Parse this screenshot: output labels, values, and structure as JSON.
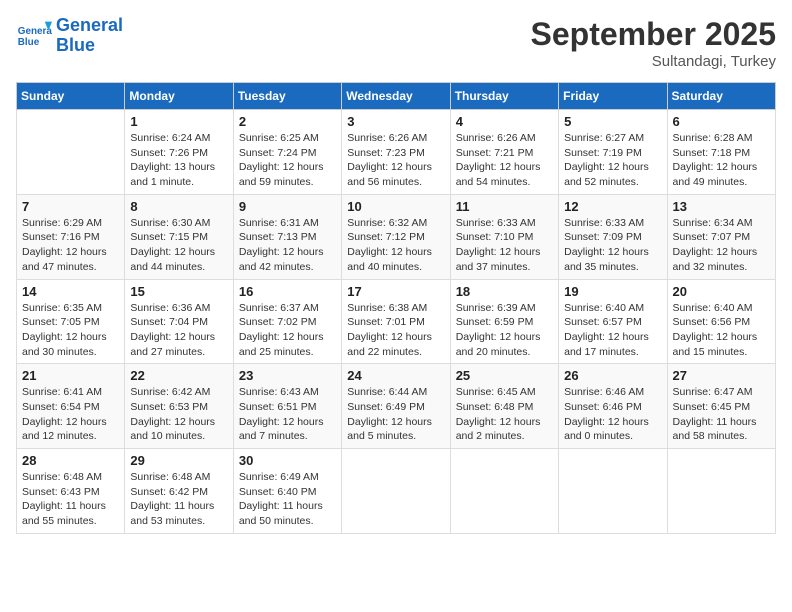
{
  "logo": {
    "line1": "General",
    "line2": "Blue"
  },
  "title": "September 2025",
  "subtitle": "Sultandagi, Turkey",
  "weekdays": [
    "Sunday",
    "Monday",
    "Tuesday",
    "Wednesday",
    "Thursday",
    "Friday",
    "Saturday"
  ],
  "weeks": [
    [
      {
        "day": "",
        "info": ""
      },
      {
        "day": "1",
        "info": "Sunrise: 6:24 AM\nSunset: 7:26 PM\nDaylight: 13 hours\nand 1 minute."
      },
      {
        "day": "2",
        "info": "Sunrise: 6:25 AM\nSunset: 7:24 PM\nDaylight: 12 hours\nand 59 minutes."
      },
      {
        "day": "3",
        "info": "Sunrise: 6:26 AM\nSunset: 7:23 PM\nDaylight: 12 hours\nand 56 minutes."
      },
      {
        "day": "4",
        "info": "Sunrise: 6:26 AM\nSunset: 7:21 PM\nDaylight: 12 hours\nand 54 minutes."
      },
      {
        "day": "5",
        "info": "Sunrise: 6:27 AM\nSunset: 7:19 PM\nDaylight: 12 hours\nand 52 minutes."
      },
      {
        "day": "6",
        "info": "Sunrise: 6:28 AM\nSunset: 7:18 PM\nDaylight: 12 hours\nand 49 minutes."
      }
    ],
    [
      {
        "day": "7",
        "info": "Sunrise: 6:29 AM\nSunset: 7:16 PM\nDaylight: 12 hours\nand 47 minutes."
      },
      {
        "day": "8",
        "info": "Sunrise: 6:30 AM\nSunset: 7:15 PM\nDaylight: 12 hours\nand 44 minutes."
      },
      {
        "day": "9",
        "info": "Sunrise: 6:31 AM\nSunset: 7:13 PM\nDaylight: 12 hours\nand 42 minutes."
      },
      {
        "day": "10",
        "info": "Sunrise: 6:32 AM\nSunset: 7:12 PM\nDaylight: 12 hours\nand 40 minutes."
      },
      {
        "day": "11",
        "info": "Sunrise: 6:33 AM\nSunset: 7:10 PM\nDaylight: 12 hours\nand 37 minutes."
      },
      {
        "day": "12",
        "info": "Sunrise: 6:33 AM\nSunset: 7:09 PM\nDaylight: 12 hours\nand 35 minutes."
      },
      {
        "day": "13",
        "info": "Sunrise: 6:34 AM\nSunset: 7:07 PM\nDaylight: 12 hours\nand 32 minutes."
      }
    ],
    [
      {
        "day": "14",
        "info": "Sunrise: 6:35 AM\nSunset: 7:05 PM\nDaylight: 12 hours\nand 30 minutes."
      },
      {
        "day": "15",
        "info": "Sunrise: 6:36 AM\nSunset: 7:04 PM\nDaylight: 12 hours\nand 27 minutes."
      },
      {
        "day": "16",
        "info": "Sunrise: 6:37 AM\nSunset: 7:02 PM\nDaylight: 12 hours\nand 25 minutes."
      },
      {
        "day": "17",
        "info": "Sunrise: 6:38 AM\nSunset: 7:01 PM\nDaylight: 12 hours\nand 22 minutes."
      },
      {
        "day": "18",
        "info": "Sunrise: 6:39 AM\nSunset: 6:59 PM\nDaylight: 12 hours\nand 20 minutes."
      },
      {
        "day": "19",
        "info": "Sunrise: 6:40 AM\nSunset: 6:57 PM\nDaylight: 12 hours\nand 17 minutes."
      },
      {
        "day": "20",
        "info": "Sunrise: 6:40 AM\nSunset: 6:56 PM\nDaylight: 12 hours\nand 15 minutes."
      }
    ],
    [
      {
        "day": "21",
        "info": "Sunrise: 6:41 AM\nSunset: 6:54 PM\nDaylight: 12 hours\nand 12 minutes."
      },
      {
        "day": "22",
        "info": "Sunrise: 6:42 AM\nSunset: 6:53 PM\nDaylight: 12 hours\nand 10 minutes."
      },
      {
        "day": "23",
        "info": "Sunrise: 6:43 AM\nSunset: 6:51 PM\nDaylight: 12 hours\nand 7 minutes."
      },
      {
        "day": "24",
        "info": "Sunrise: 6:44 AM\nSunset: 6:49 PM\nDaylight: 12 hours\nand 5 minutes."
      },
      {
        "day": "25",
        "info": "Sunrise: 6:45 AM\nSunset: 6:48 PM\nDaylight: 12 hours\nand 2 minutes."
      },
      {
        "day": "26",
        "info": "Sunrise: 6:46 AM\nSunset: 6:46 PM\nDaylight: 12 hours\nand 0 minutes."
      },
      {
        "day": "27",
        "info": "Sunrise: 6:47 AM\nSunset: 6:45 PM\nDaylight: 11 hours\nand 58 minutes."
      }
    ],
    [
      {
        "day": "28",
        "info": "Sunrise: 6:48 AM\nSunset: 6:43 PM\nDaylight: 11 hours\nand 55 minutes."
      },
      {
        "day": "29",
        "info": "Sunrise: 6:48 AM\nSunset: 6:42 PM\nDaylight: 11 hours\nand 53 minutes."
      },
      {
        "day": "30",
        "info": "Sunrise: 6:49 AM\nSunset: 6:40 PM\nDaylight: 11 hours\nand 50 minutes."
      },
      {
        "day": "",
        "info": ""
      },
      {
        "day": "",
        "info": ""
      },
      {
        "day": "",
        "info": ""
      },
      {
        "day": "",
        "info": ""
      }
    ]
  ]
}
